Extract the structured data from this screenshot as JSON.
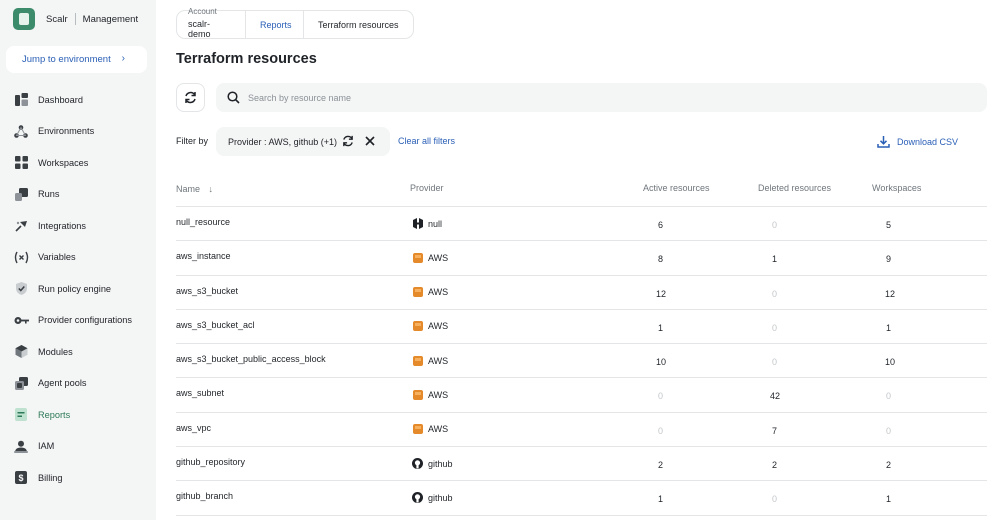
{
  "brand": {
    "name": "Scalr",
    "section": "Management"
  },
  "sidebar": {
    "jump_label": "Jump to environment",
    "items": [
      {
        "label": "Dashboard",
        "icon": "dashboard-icon"
      },
      {
        "label": "Environments",
        "icon": "environments-icon"
      },
      {
        "label": "Workspaces",
        "icon": "workspaces-icon"
      },
      {
        "label": "Runs",
        "icon": "runs-icon"
      },
      {
        "label": "Integrations",
        "icon": "integrations-icon"
      },
      {
        "label": "Variables",
        "icon": "variables-icon"
      },
      {
        "label": "Run policy engine",
        "icon": "policy-icon"
      },
      {
        "label": "Provider configurations",
        "icon": "key-icon"
      },
      {
        "label": "Modules",
        "icon": "modules-icon"
      },
      {
        "label": "Agent pools",
        "icon": "agent-pools-icon"
      },
      {
        "label": "Reports",
        "icon": "reports-icon",
        "active": true
      },
      {
        "label": "IAM",
        "icon": "iam-icon"
      },
      {
        "label": "Billing",
        "icon": "billing-icon"
      }
    ]
  },
  "breadcrumb": {
    "account_caption": "Account",
    "account": "scalr-demo",
    "reports": "Reports",
    "current": "Terraform resources"
  },
  "page": {
    "title": "Terraform resources",
    "search_placeholder": "Search by resource name",
    "filter_by": "Filter by",
    "filter_chip": "Provider : AWS, github (+1)",
    "clear_filters": "Clear all filters",
    "download_csv": "Download CSV"
  },
  "colors": {
    "accent": "#2a5fb6",
    "active_nav": "#2d7a58",
    "brand": "#3c8c6c",
    "aws": "#e58a2b"
  },
  "table": {
    "headers": {
      "name": "Name",
      "provider": "Provider",
      "active": "Active resources",
      "deleted": "Deleted resources",
      "workspaces": "Workspaces"
    },
    "rows": [
      {
        "name": "null_resource",
        "provider": "null",
        "provider_icon": "hashicorp-icon",
        "active": "6",
        "deleted": "0",
        "workspaces": "5"
      },
      {
        "name": "aws_instance",
        "provider": "AWS",
        "provider_icon": "aws-icon",
        "active": "8",
        "deleted": "1",
        "workspaces": "9"
      },
      {
        "name": "aws_s3_bucket",
        "provider": "AWS",
        "provider_icon": "aws-icon",
        "active": "12",
        "deleted": "0",
        "workspaces": "12"
      },
      {
        "name": "aws_s3_bucket_acl",
        "provider": "AWS",
        "provider_icon": "aws-icon",
        "active": "1",
        "deleted": "0",
        "workspaces": "1"
      },
      {
        "name": "aws_s3_bucket_public_access_block",
        "provider": "AWS",
        "provider_icon": "aws-icon",
        "active": "10",
        "deleted": "0",
        "workspaces": "10"
      },
      {
        "name": "aws_subnet",
        "provider": "AWS",
        "provider_icon": "aws-icon",
        "active": "0",
        "deleted": "42",
        "workspaces": "0"
      },
      {
        "name": "aws_vpc",
        "provider": "AWS",
        "provider_icon": "aws-icon",
        "active": "0",
        "deleted": "7",
        "workspaces": "0"
      },
      {
        "name": "github_repository",
        "provider": "github",
        "provider_icon": "github-icon",
        "active": "2",
        "deleted": "2",
        "workspaces": "2"
      },
      {
        "name": "github_branch",
        "provider": "github",
        "provider_icon": "github-icon",
        "active": "1",
        "deleted": "0",
        "workspaces": "1"
      }
    ]
  }
}
